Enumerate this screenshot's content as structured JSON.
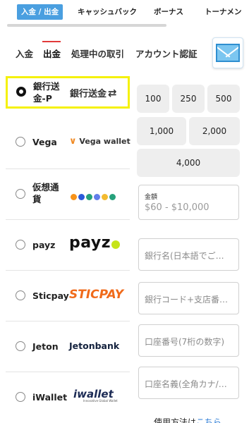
{
  "top_tabs": [
    "入金 / 出金",
    "キャッシュバック",
    "ボーナス",
    "トーナメン"
  ],
  "sub_tabs": [
    "入金",
    "出金",
    "処理中の取引",
    "アカウント認証"
  ],
  "methods": [
    {
      "name_line1": "銀行送",
      "name_line2": "金-P",
      "logo": "銀行送金",
      "selected": true
    },
    {
      "name": "Vega",
      "logo": "Vega wallet"
    },
    {
      "name_line1": "仮想通",
      "name_line2": "貨",
      "logo": "crypto"
    },
    {
      "name": "payz",
      "logo": "payz"
    },
    {
      "name": "Sticpay",
      "logo": "STICPAY"
    },
    {
      "name": "Jeton",
      "logo": "Jetonbank"
    },
    {
      "name": "iWallet",
      "logo": "wallet",
      "logo_sub": "Innovative Global Wallet"
    }
  ],
  "amounts": [
    "100",
    "250",
    "500",
    "1,000",
    "2,000",
    "4,000"
  ],
  "amount_field": {
    "label": "金額",
    "value": "$60 - $10,000"
  },
  "bank_fields": {
    "bank_name": "銀行名(日本語でご…",
    "bank_code": "銀行コード+支店番…",
    "account_number": "口座番号(7桁の数字)",
    "account_holder": "口座名義(全角カナ/…"
  },
  "bottom_note": {
    "text": "使用方法は",
    "link": "こちら"
  },
  "colors": {
    "accent": "#4a9fe0",
    "highlight": "#f5f10a",
    "sticpay": "#f06a1a"
  }
}
